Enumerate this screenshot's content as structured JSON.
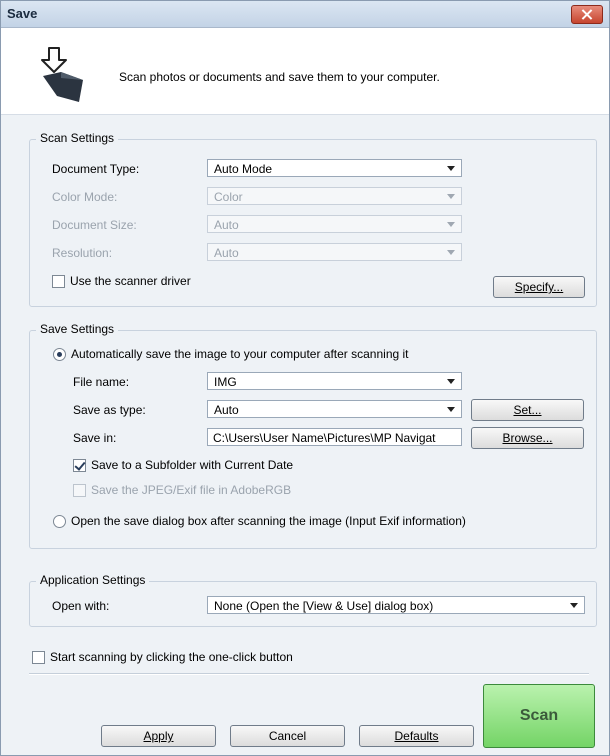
{
  "window": {
    "title": "Save"
  },
  "header": {
    "text": "Scan photos or documents and save them to your computer."
  },
  "scan_settings": {
    "legend": "Scan Settings",
    "document_type": {
      "label": "Document Type:",
      "value": "Auto Mode"
    },
    "color_mode": {
      "label": "Color Mode:",
      "value": "Color"
    },
    "document_size": {
      "label": "Document Size:",
      "value": "Auto"
    },
    "resolution": {
      "label": "Resolution:",
      "value": "Auto"
    },
    "use_scanner_driver": {
      "label": "Use the scanner driver",
      "checked": false
    },
    "specify_button": "Specify..."
  },
  "save_settings": {
    "legend": "Save Settings",
    "auto_save": {
      "label": "Automatically save the image to your computer after scanning it",
      "selected": true
    },
    "file_name": {
      "label": "File name:",
      "value": "IMG"
    },
    "save_as_type": {
      "label": "Save as type:",
      "value": "Auto"
    },
    "set_button": "Set...",
    "save_in": {
      "label": "Save in:",
      "value": "C:\\Users\\User Name\\Pictures\\MP Navigat"
    },
    "browse_button": "Browse...",
    "subfolder": {
      "label": "Save to a Subfolder with Current Date",
      "checked": true
    },
    "adobergb": {
      "label": "Save the JPEG/Exif file in AdobeRGB",
      "checked": false
    },
    "open_dialog": {
      "label": "Open the save dialog box after scanning the image (Input Exif information)",
      "selected": false
    }
  },
  "application_settings": {
    "legend": "Application Settings",
    "open_with": {
      "label": "Open with:",
      "value": "None (Open the [View & Use] dialog box)"
    }
  },
  "one_click": {
    "label": "Start scanning by clicking the one-click button",
    "checked": false
  },
  "footer": {
    "apply": "Apply",
    "cancel": "Cancel",
    "defaults": "Defaults",
    "scan": "Scan"
  },
  "colors": {
    "scan_button": "#8ee07f",
    "title_bar": "#c9d8ea"
  }
}
